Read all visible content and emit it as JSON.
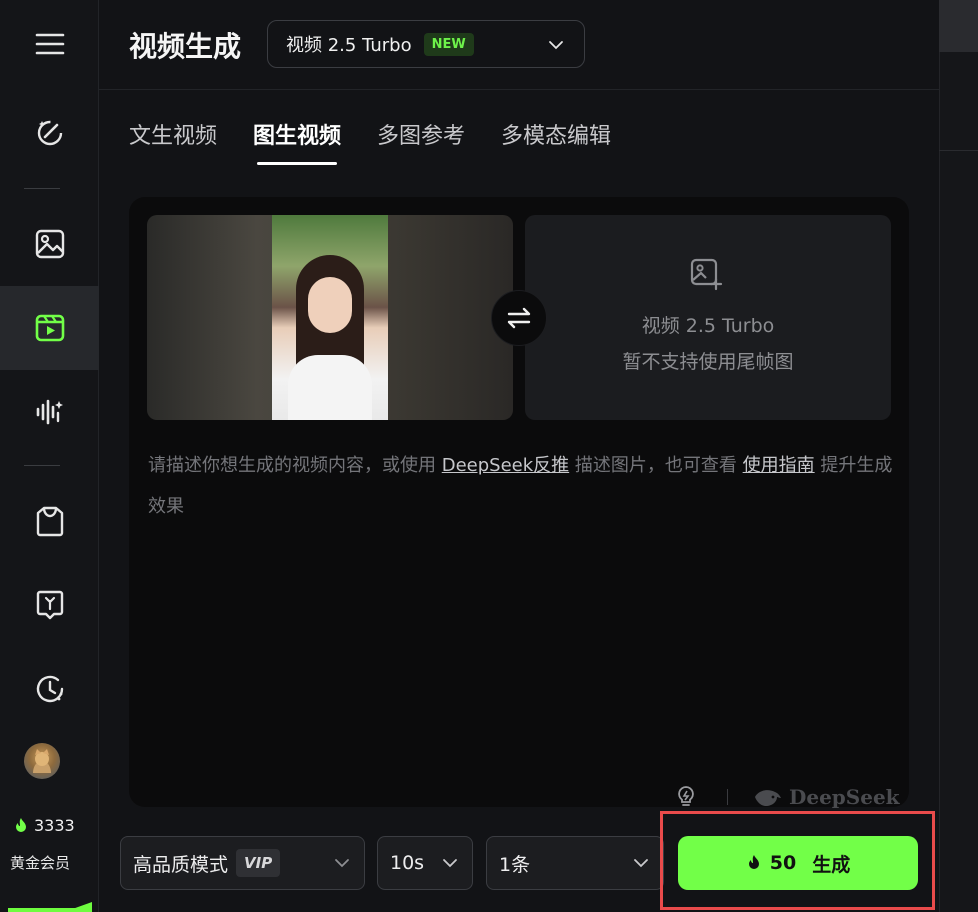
{
  "sidebar": {
    "items": [
      {
        "icon": "menu-icon"
      },
      {
        "icon": "magic-wand-icon"
      },
      {
        "icon": "image-icon"
      },
      {
        "icon": "video-icon",
        "active": true
      },
      {
        "icon": "audio-wave-icon"
      },
      {
        "icon": "shirt-icon"
      },
      {
        "icon": "lightbulb-chat-icon"
      },
      {
        "icon": "history-icon"
      }
    ],
    "credits": "3333",
    "member_label": "黄金会员"
  },
  "header": {
    "title": "视频生成",
    "model_name": "视频 2.5 Turbo",
    "model_badge": "NEW"
  },
  "tabs": [
    {
      "label": "文生视频",
      "active": false
    },
    {
      "label": "图生视频",
      "active": true
    },
    {
      "label": "多图参考",
      "active": false
    },
    {
      "label": "多模态编辑",
      "active": false
    }
  ],
  "editor": {
    "end_frame_model": "视频 2.5 Turbo",
    "end_frame_note": "暂不支持使用尾帧图",
    "prompt_part1": "请描述你想生成的视频内容，或使用 ",
    "prompt_link1": "DeepSeek反推",
    "prompt_part2": " 描述图片，也可查看 ",
    "prompt_link2": "使用指南",
    "prompt_part3": " 提升生成效果",
    "brand": "DeepSeek"
  },
  "controls": {
    "quality_label": "高品质模式",
    "quality_badge": "VIP",
    "duration": "10s",
    "count": "1条",
    "generate_cost": "50",
    "generate_label": "生成"
  },
  "colors": {
    "accent": "#72ff48",
    "highlight_border": "#e94b4b",
    "background": "#121316"
  }
}
